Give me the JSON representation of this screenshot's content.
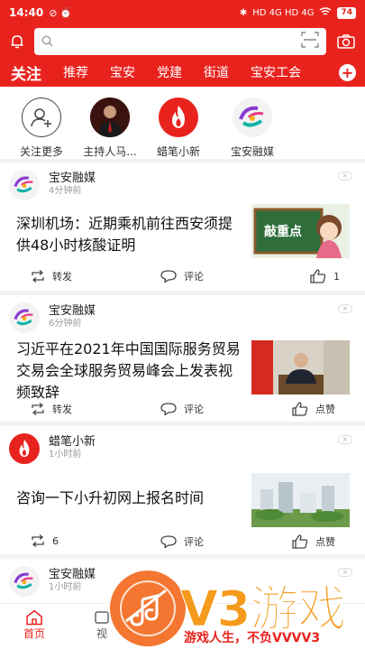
{
  "status_bar": {
    "time": "14:40",
    "signal": "HD 4G HD 4G",
    "battery": "74"
  },
  "search": {
    "placeholder": ""
  },
  "tabs": [
    {
      "label": "关注",
      "active": true
    },
    {
      "label": "推荐"
    },
    {
      "label": "宝安"
    },
    {
      "label": "党建"
    },
    {
      "label": "街道"
    },
    {
      "label": "宝安工会"
    }
  ],
  "follows": [
    {
      "label": "关注更多",
      "icon": "add-user-icon"
    },
    {
      "label": "主持人马...",
      "icon": "host-avatar"
    },
    {
      "label": "蜡笔小新",
      "icon": "flame-logo"
    },
    {
      "label": "宝安融媒",
      "icon": "baoan-media-logo"
    }
  ],
  "articles": [
    {
      "source": "宝安融媒",
      "time": "4分钟前",
      "title": "深圳机场：近期乘机前往西安须提供48小时核酸证明",
      "thumb_text": "敲重点",
      "actions": {
        "share": "转发",
        "comment": "评论",
        "like": "1"
      }
    },
    {
      "source": "宝安融媒",
      "time": "6分钟前",
      "title": "习近平在2021年中国国际服务贸易交易会全球服务贸易峰会上发表视频致辞",
      "actions": {
        "share": "转发",
        "comment": "评论",
        "like": "点赞"
      }
    },
    {
      "source": "蜡笔小新",
      "time": "1小时前",
      "title": "咨询一下小升初网上报名时间",
      "actions": {
        "share": "6",
        "comment": "评论",
        "like": "点赞"
      }
    },
    {
      "source": "宝安融媒",
      "time": "1小时前"
    }
  ],
  "bottom_nav": [
    {
      "label": "首页",
      "active": true
    },
    {
      "label": "视"
    }
  ],
  "watermark": {
    "brand": "V3游戏",
    "slogan": "游戏人生，不负VVVV3"
  },
  "colors": {
    "primary": "#e8231e",
    "watermark_orange": "#f59a1c"
  }
}
